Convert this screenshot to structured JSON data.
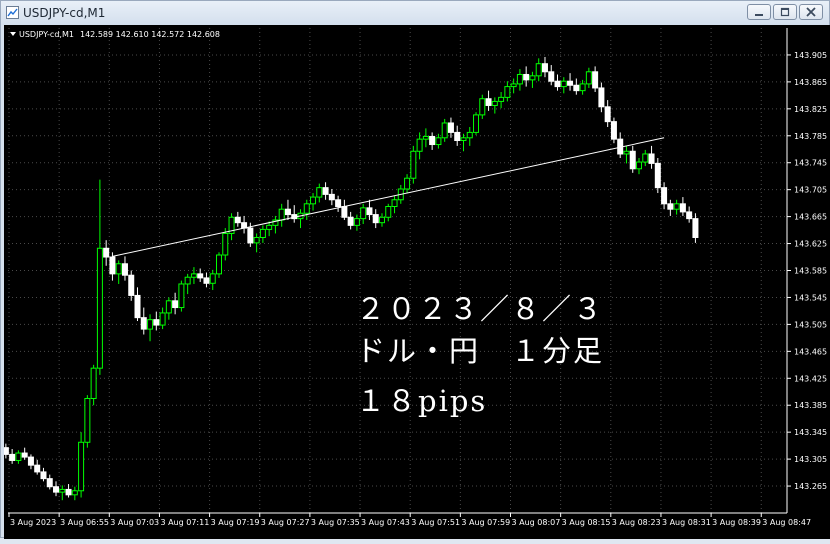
{
  "window": {
    "title": "USDJPY-cd,M1",
    "minimize_icon": "minimize-icon",
    "restore_icon": "restore-icon",
    "close_icon": "close-icon"
  },
  "chart_header": {
    "symbol": "USDJPY-cd,M1",
    "ohlc": "142.589 142.610 142.572 142.608"
  },
  "annotation": {
    "line1": "２０２３／８／３",
    "line2": "ドル・円　１分足",
    "line3": "１８pips"
  },
  "chart_data": {
    "type": "candlestick",
    "symbol": "USDJPY-cd",
    "timeframe": "M1",
    "up_color": "#00ff00",
    "down_color": "#ffffff",
    "background": "#000000",
    "grid": true,
    "ylim": [
      143.225,
      143.945
    ],
    "y_ticks": [
      "143.905",
      "143.865",
      "143.825",
      "143.785",
      "143.745",
      "143.705",
      "143.665",
      "143.625",
      "143.585",
      "143.545",
      "143.505",
      "143.465",
      "143.425",
      "143.385",
      "143.345",
      "143.305",
      "143.265"
    ],
    "x_ticks": [
      "3 Aug 2023",
      "3 Aug 06:55",
      "3 Aug 07:03",
      "3 Aug 07:11",
      "3 Aug 07:19",
      "3 Aug 07:27",
      "3 Aug 07:35",
      "3 Aug 07:43",
      "3 Aug 07:51",
      "3 Aug 07:59",
      "3 Aug 08:07",
      "3 Aug 08:15",
      "3 Aug 08:23",
      "3 Aug 08:31",
      "3 Aug 08:39",
      "3 Aug 08:47"
    ],
    "trend_line": {
      "start": [
        "3 Aug 07:03",
        143.606
      ],
      "end": [
        "3 Aug 08:31",
        143.782
      ]
    },
    "candles": [
      [
        143.33,
        143.336,
        143.318,
        143.322
      ],
      [
        143.322,
        143.328,
        143.306,
        143.312
      ],
      [
        143.312,
        143.32,
        143.298,
        143.303
      ],
      [
        143.303,
        143.318,
        143.298,
        143.314
      ],
      [
        143.314,
        143.322,
        143.304,
        143.308
      ],
      [
        143.308,
        143.312,
        143.29,
        143.296
      ],
      [
        143.296,
        143.304,
        143.282,
        143.286
      ],
      [
        143.286,
        143.292,
        143.272,
        143.276
      ],
      [
        143.276,
        143.282,
        143.26,
        143.264
      ],
      [
        143.264,
        143.272,
        143.25,
        143.256
      ],
      [
        143.256,
        143.266,
        143.244,
        143.26
      ],
      [
        143.26,
        143.268,
        143.248,
        143.252
      ],
      [
        143.252,
        143.264,
        143.244,
        143.258
      ],
      [
        143.258,
        143.345,
        143.248,
        143.33
      ],
      [
        143.33,
        143.4,
        143.322,
        143.395
      ],
      [
        143.395,
        143.445,
        143.385,
        143.44
      ],
      [
        143.44,
        143.72,
        143.43,
        143.618
      ],
      [
        143.618,
        143.63,
        143.592,
        143.605
      ],
      [
        143.605,
        143.612,
        143.57,
        143.58
      ],
      [
        143.58,
        143.6,
        143.565,
        143.595
      ],
      [
        143.595,
        143.606,
        143.57,
        143.578
      ],
      [
        143.578,
        143.585,
        143.54,
        143.548
      ],
      [
        143.548,
        143.56,
        143.51,
        143.515
      ],
      [
        143.515,
        143.53,
        143.49,
        143.498
      ],
      [
        143.498,
        143.52,
        143.48,
        143.512
      ],
      [
        143.512,
        143.524,
        143.496,
        143.504
      ],
      [
        143.504,
        143.53,
        143.498,
        143.522
      ],
      [
        143.522,
        143.545,
        143.512,
        143.54
      ],
      [
        143.54,
        143.552,
        143.52,
        143.53
      ],
      [
        143.53,
        143.57,
        143.524,
        143.565
      ],
      [
        143.565,
        143.58,
        143.55,
        143.575
      ],
      [
        143.575,
        143.59,
        143.565,
        143.58
      ],
      [
        143.58,
        143.588,
        143.568,
        143.574
      ],
      [
        143.574,
        143.582,
        143.56,
        143.566
      ],
      [
        143.566,
        143.586,
        143.556,
        143.58
      ],
      [
        143.58,
        143.612,
        143.574,
        143.608
      ],
      [
        143.608,
        143.648,
        143.6,
        143.64
      ],
      [
        143.64,
        143.67,
        143.63,
        143.664
      ],
      [
        143.664,
        143.672,
        143.65,
        143.656
      ],
      [
        143.656,
        143.666,
        143.64,
        143.648
      ],
      [
        143.648,
        143.656,
        143.62,
        143.626
      ],
      [
        143.626,
        143.64,
        143.612,
        143.634
      ],
      [
        143.634,
        143.652,
        143.626,
        143.646
      ],
      [
        143.646,
        143.658,
        143.636,
        143.652
      ],
      [
        143.652,
        143.666,
        143.64,
        143.66
      ],
      [
        143.66,
        143.684,
        143.65,
        143.676
      ],
      [
        143.676,
        143.69,
        143.66,
        143.668
      ],
      [
        143.668,
        143.682,
        143.656,
        143.662
      ],
      [
        143.662,
        143.676,
        143.648,
        143.67
      ],
      [
        143.67,
        143.69,
        143.66,
        143.684
      ],
      [
        143.684,
        143.7,
        143.674,
        143.694
      ],
      [
        143.694,
        143.714,
        143.686,
        143.708
      ],
      [
        143.708,
        143.716,
        143.69,
        143.698
      ],
      [
        143.698,
        143.706,
        143.682,
        143.69
      ],
      [
        143.69,
        143.696,
        143.672,
        143.68
      ],
      [
        143.68,
        143.69,
        143.66,
        143.664
      ],
      [
        143.664,
        143.672,
        143.646,
        143.652
      ],
      [
        143.652,
        143.668,
        143.644,
        143.662
      ],
      [
        143.662,
        143.684,
        143.654,
        143.678
      ],
      [
        143.678,
        143.69,
        143.66,
        143.668
      ],
      [
        143.668,
        143.676,
        143.648,
        143.656
      ],
      [
        143.656,
        143.67,
        143.65,
        143.664
      ],
      [
        143.664,
        143.684,
        143.658,
        143.68
      ],
      [
        143.68,
        143.696,
        143.67,
        143.69
      ],
      [
        143.69,
        143.712,
        143.684,
        143.706
      ],
      [
        143.706,
        143.728,
        143.7,
        143.722
      ],
      [
        143.722,
        143.77,
        143.714,
        143.762
      ],
      [
        143.762,
        143.79,
        143.75,
        143.78
      ],
      [
        143.78,
        143.796,
        143.768,
        143.784
      ],
      [
        143.784,
        143.79,
        143.764,
        143.772
      ],
      [
        143.772,
        143.788,
        143.766,
        143.782
      ],
      [
        143.782,
        143.81,
        143.776,
        143.804
      ],
      [
        143.804,
        143.812,
        143.782,
        143.79
      ],
      [
        143.79,
        143.8,
        143.77,
        143.778
      ],
      [
        143.778,
        143.788,
        143.762,
        143.782
      ],
      [
        143.782,
        143.798,
        143.77,
        143.79
      ],
      [
        143.79,
        143.82,
        143.786,
        143.816
      ],
      [
        143.816,
        143.846,
        143.81,
        143.84
      ],
      [
        143.84,
        143.852,
        143.822,
        143.83
      ],
      [
        143.83,
        143.842,
        143.818,
        143.836
      ],
      [
        143.836,
        143.85,
        143.826,
        143.842
      ],
      [
        143.842,
        143.866,
        143.836,
        143.858
      ],
      [
        143.858,
        143.87,
        143.848,
        143.862
      ],
      [
        143.862,
        143.884,
        143.852,
        143.876
      ],
      [
        143.876,
        143.888,
        143.858,
        143.868
      ],
      [
        143.868,
        143.88,
        143.856,
        143.874
      ],
      [
        143.874,
        143.9,
        143.866,
        143.892
      ],
      [
        143.892,
        143.902,
        143.872,
        143.88
      ],
      [
        143.88,
        143.89,
        143.86,
        143.866
      ],
      [
        143.866,
        143.876,
        143.852,
        143.858
      ],
      [
        143.858,
        143.872,
        143.848,
        143.866
      ],
      [
        143.866,
        143.878,
        143.852,
        143.86
      ],
      [
        143.86,
        143.87,
        143.846,
        143.852
      ],
      [
        143.852,
        143.868,
        143.846,
        143.862
      ],
      [
        143.862,
        143.886,
        143.856,
        143.88
      ],
      [
        143.88,
        143.888,
        143.85,
        143.856
      ],
      [
        143.856,
        143.864,
        143.82,
        143.828
      ],
      [
        143.828,
        143.838,
        143.798,
        143.806
      ],
      [
        143.806,
        143.812,
        143.774,
        143.78
      ],
      [
        143.78,
        143.79,
        143.752,
        143.758
      ],
      [
        143.758,
        143.77,
        143.744,
        143.762
      ],
      [
        143.762,
        143.77,
        143.73,
        143.736
      ],
      [
        143.736,
        143.752,
        143.728,
        143.746
      ],
      [
        143.746,
        143.764,
        143.74,
        143.758
      ],
      [
        143.758,
        143.77,
        143.736,
        143.744
      ],
      [
        143.744,
        143.752,
        143.7,
        143.708
      ],
      [
        143.708,
        143.716,
        143.676,
        143.684
      ],
      [
        143.684,
        143.69,
        143.666,
        143.676
      ],
      [
        143.676,
        143.69,
        143.668,
        143.684
      ],
      [
        143.684,
        143.694,
        143.666,
        143.672
      ],
      [
        143.672,
        143.68,
        143.656,
        143.662
      ],
      [
        143.662,
        143.67,
        143.626,
        143.634
      ]
    ]
  }
}
